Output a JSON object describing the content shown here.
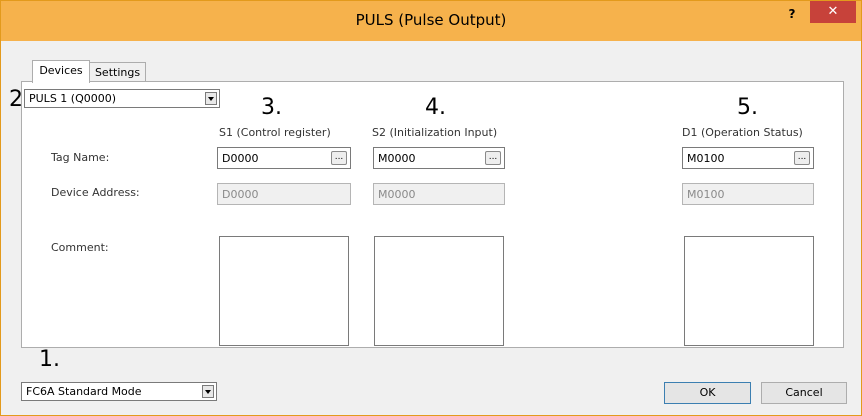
{
  "window": {
    "title": "PULS (Pulse Output)",
    "help_label": "?",
    "close_label": "✕"
  },
  "tabs": [
    {
      "label": "Devices",
      "active": true
    },
    {
      "label": "Settings",
      "active": false
    }
  ],
  "channel_select": {
    "value": "PULS 1 (Q0000)"
  },
  "callouts": {
    "one": "1.",
    "two": "2.",
    "three": "3.",
    "four": "4.",
    "five": "5."
  },
  "row_labels": {
    "tag_name": "Tag Name:",
    "device_address": "Device Address:",
    "comment": "Comment:"
  },
  "columns": [
    {
      "header": "S1 (Control register)",
      "tag": "D0000",
      "address": "D0000",
      "comment": ""
    },
    {
      "header": "S2 (Initialization Input)",
      "tag": "M0000",
      "address": "M0000",
      "comment": ""
    },
    {
      "header": "D1 (Operation Status)",
      "tag": "M0100",
      "address": "M0100",
      "comment": ""
    }
  ],
  "browse_label": "...",
  "mode_select": {
    "value": "FC6A Standard Mode"
  },
  "buttons": {
    "ok": "OK",
    "cancel": "Cancel"
  },
  "colors": {
    "title_bar": "#f6b24c",
    "close_button": "#c7423a"
  }
}
